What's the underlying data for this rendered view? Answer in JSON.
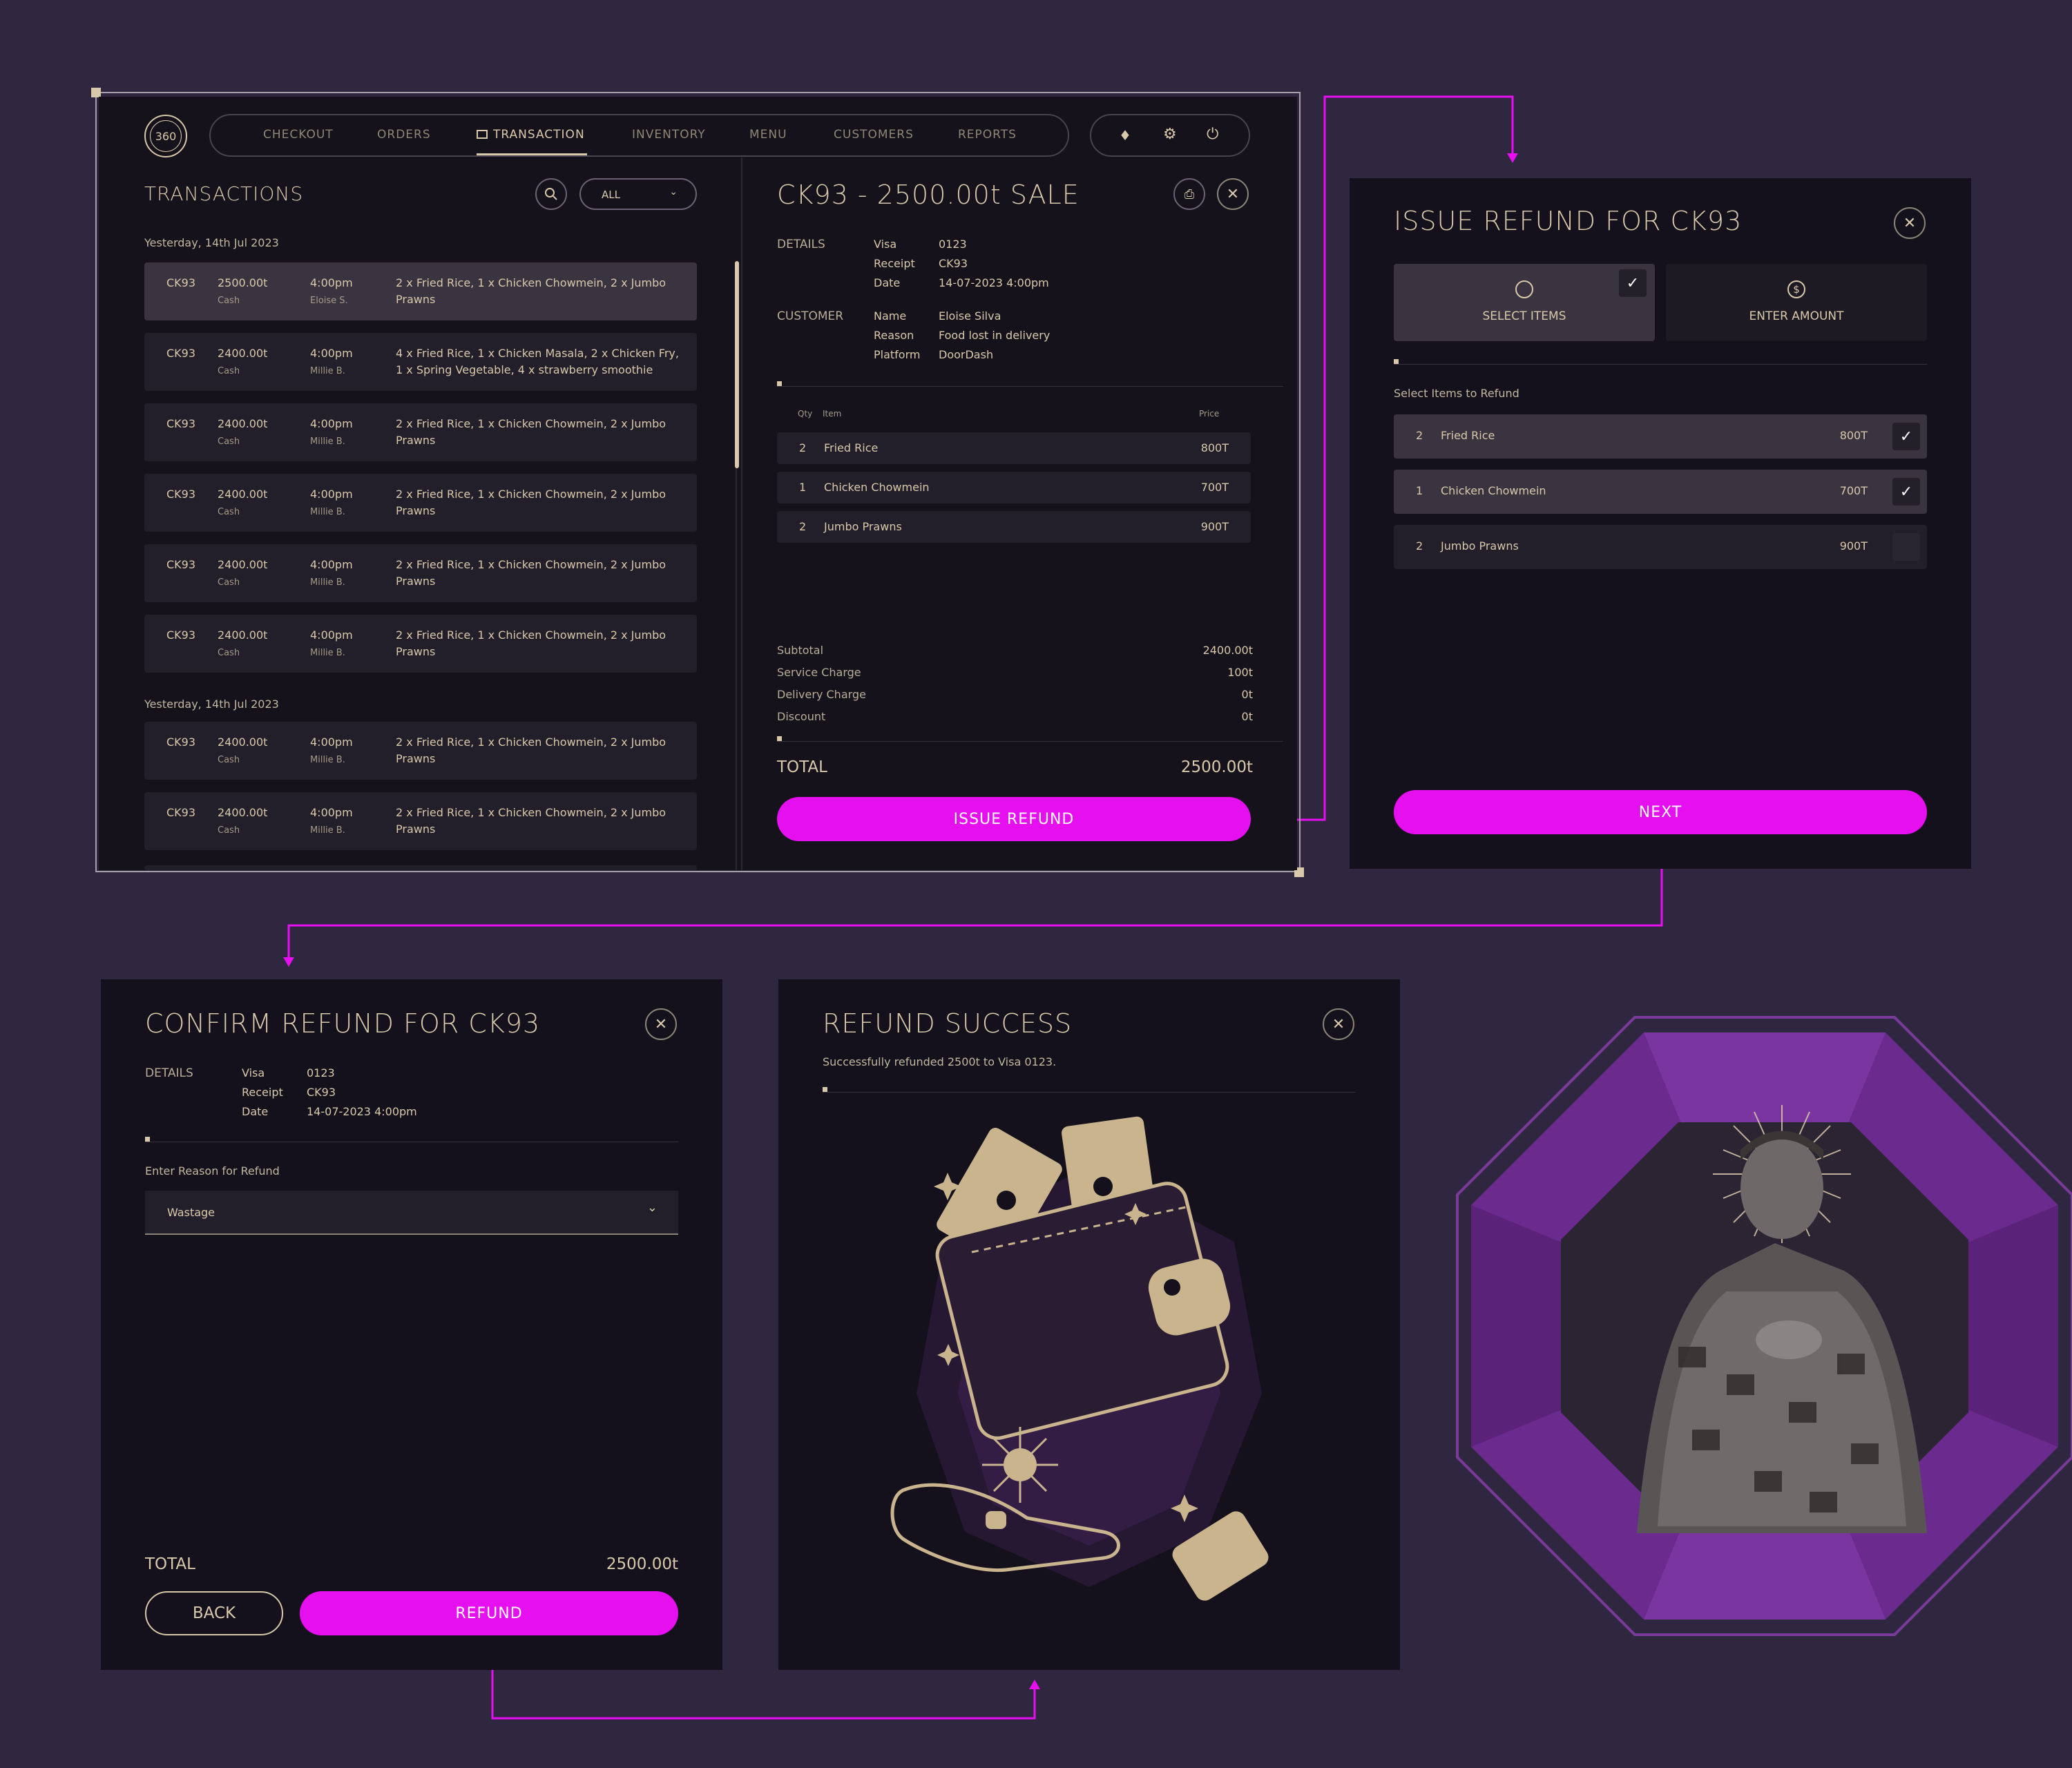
{
  "nav": {
    "logo": "360",
    "items": [
      "CHECKOUT",
      "ORDERS",
      "TRANSACTION",
      "INVENTORY",
      "MENU",
      "CUSTOMERS",
      "REPORTS"
    ]
  },
  "transactions": {
    "title": "TRANSACTIONS",
    "filter": "ALL",
    "group1_date": "Yesterday, 14th Jul 2023",
    "group2_date": "Yesterday, 14th Jul 2023",
    "group1": [
      {
        "id": "CK93",
        "amount": "2500.00t",
        "method": "Cash",
        "time": "4:00pm",
        "staff": "Eloise S.",
        "items": "2 x Fried Rice, 1 x Chicken Chowmein, 2 x Jumbo",
        "items2": "Prawns"
      },
      {
        "id": "CK93",
        "amount": "2400.00t",
        "method": "Cash",
        "time": "4:00pm",
        "staff": "Millie B.",
        "items": "4 x Fried Rice, 1 x Chicken Masala, 2 x Chicken Fry,",
        "items2": "1 x Spring Vegetable, 4 x strawberry smoothie"
      },
      {
        "id": "CK93",
        "amount": "2400.00t",
        "method": "Cash",
        "time": "4:00pm",
        "staff": "Millie B.",
        "items": "2 x Fried Rice, 1 x Chicken Chowmein, 2 x Jumbo",
        "items2": "Prawns"
      },
      {
        "id": "CK93",
        "amount": "2400.00t",
        "method": "Cash",
        "time": "4:00pm",
        "staff": "Millie B.",
        "items": "2 x Fried Rice, 1 x Chicken Chowmein, 2 x Jumbo",
        "items2": "Prawns"
      },
      {
        "id": "CK93",
        "amount": "2400.00t",
        "method": "Cash",
        "time": "4:00pm",
        "staff": "Millie B.",
        "items": "2 x Fried Rice, 1 x Chicken Chowmein, 2 x Jumbo",
        "items2": "Prawns"
      },
      {
        "id": "CK93",
        "amount": "2400.00t",
        "method": "Cash",
        "time": "4:00pm",
        "staff": "Millie B.",
        "items": "2 x Fried Rice, 1 x Chicken Chowmein, 2 x Jumbo",
        "items2": "Prawns"
      }
    ],
    "group2": [
      {
        "id": "CK93",
        "amount": "2400.00t",
        "method": "Cash",
        "time": "4:00pm",
        "staff": "Millie B.",
        "items": "2 x Fried Rice, 1 x Chicken Chowmein, 2 x Jumbo",
        "items2": "Prawns"
      },
      {
        "id": "CK93",
        "amount": "2400.00t",
        "method": "Cash",
        "time": "4:00pm",
        "staff": "Millie B.",
        "items": "2 x Fried Rice, 1 x Chicken Chowmein, 2 x Jumbo",
        "items2": "Prawns"
      }
    ]
  },
  "sale": {
    "title": "CK93 - 2500.00t SALE",
    "details_label": "DETAILS",
    "details": [
      [
        "Visa",
        "0123"
      ],
      [
        "Receipt",
        "CK93"
      ],
      [
        "Date",
        "14-07-2023 4:00pm"
      ]
    ],
    "customer_label": "CUSTOMER",
    "customer": [
      [
        "Name",
        "Eloise Silva"
      ],
      [
        "Reason",
        "Food lost in delivery"
      ],
      [
        "Platform",
        "DoorDash"
      ]
    ],
    "col_qty": "Qty",
    "col_item": "Item",
    "col_price": "Price",
    "lines": [
      [
        "2",
        "Fried Rice",
        "800T"
      ],
      [
        "1",
        "Chicken Chowmein",
        "700T"
      ],
      [
        "2",
        "Jumbo Prawns",
        "900T"
      ]
    ],
    "summary": [
      [
        "Subtotal",
        "2400.00t"
      ],
      [
        "Service Charge",
        "100t"
      ],
      [
        "Delivery Charge",
        "0t"
      ],
      [
        "Discount",
        "0t"
      ]
    ],
    "total_label": "TOTAL",
    "total": "2500.00t",
    "button": "ISSUE REFUND"
  },
  "issue_refund": {
    "title": "ISSUE REFUND FOR CK93",
    "tab1": "SELECT ITEMS",
    "tab2": "ENTER AMOUNT",
    "section": "Select Items to Refund",
    "items": [
      [
        "2",
        "Fried Rice",
        "800T"
      ],
      [
        "1",
        "Chicken Chowmein",
        "700T"
      ],
      [
        "2",
        "Jumbo Prawns",
        "900T"
      ]
    ],
    "button": "NEXT"
  },
  "confirm": {
    "title": "CONFIRM REFUND FOR CK93",
    "details_label": "DETAILS",
    "details": [
      [
        "Visa",
        "0123"
      ],
      [
        "Receipt",
        "CK93"
      ],
      [
        "Date",
        "14-07-2023 4:00pm"
      ]
    ],
    "reason_label": "Enter Reason for Refund",
    "reason_value": "Wastage",
    "total_label": "TOTAL",
    "total": "2500.00t",
    "back": "BACK",
    "refund": "REFUND"
  },
  "success": {
    "title": "REFUND SUCCESS",
    "message": "Successfully refunded 2500t to Visa 0123."
  },
  "colors": {
    "accent": "#e60ff0",
    "gold": "#d8c9aa",
    "panel": "#14111c",
    "bg": "#2f2640"
  }
}
